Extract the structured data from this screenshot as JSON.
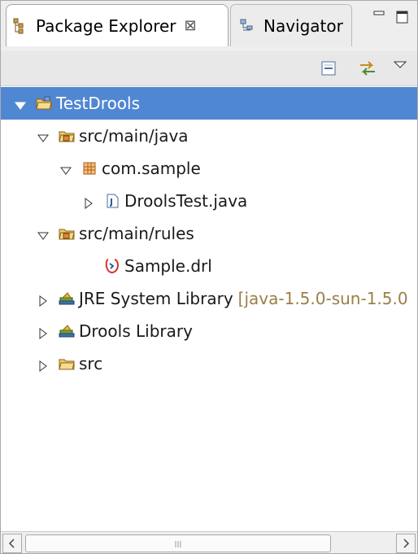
{
  "tabs": {
    "package_explorer": {
      "label": "Package Explorer",
      "close_glyph": "⊠",
      "icon": "package-explorer-icon"
    },
    "navigator": {
      "label": "Navigator",
      "icon": "navigator-icon"
    }
  },
  "window_controls": {
    "minimize_icon": "minimize-icon",
    "maximize_icon": "maximize-icon"
  },
  "toolbar": {
    "collapse_icon": "collapse-all-icon",
    "link_icon": "link-with-editor-icon",
    "menu_icon": "view-menu-icon"
  },
  "tree": {
    "items": [
      {
        "label": "TestDrools",
        "icon": "project-icon",
        "expanded": true,
        "selected": true
      },
      {
        "label": "src/main/java",
        "icon": "source-folder-icon",
        "expanded": true
      },
      {
        "label": "com.sample",
        "icon": "package-icon",
        "expanded": true
      },
      {
        "label": "DroolsTest.java",
        "icon": "java-file-icon",
        "expanded": false
      },
      {
        "label": "src/main/rules",
        "icon": "source-folder-icon",
        "expanded": true
      },
      {
        "label": "Sample.drl",
        "icon": "drools-rule-file-icon"
      },
      {
        "label": "JRE System Library",
        "decoration": "[java-1.5.0-sun-1.5.0",
        "icon": "library-icon",
        "expanded": false
      },
      {
        "label": "Drools Library",
        "icon": "library-icon",
        "expanded": false
      },
      {
        "label": "src",
        "icon": "folder-icon",
        "expanded": false
      }
    ]
  },
  "scrollbar": {
    "left_arrow": "‹",
    "right_arrow": "›",
    "grip": "grip-icon"
  },
  "colors": {
    "selection": "#5087d2",
    "decoration_text": "#9a7f47"
  }
}
